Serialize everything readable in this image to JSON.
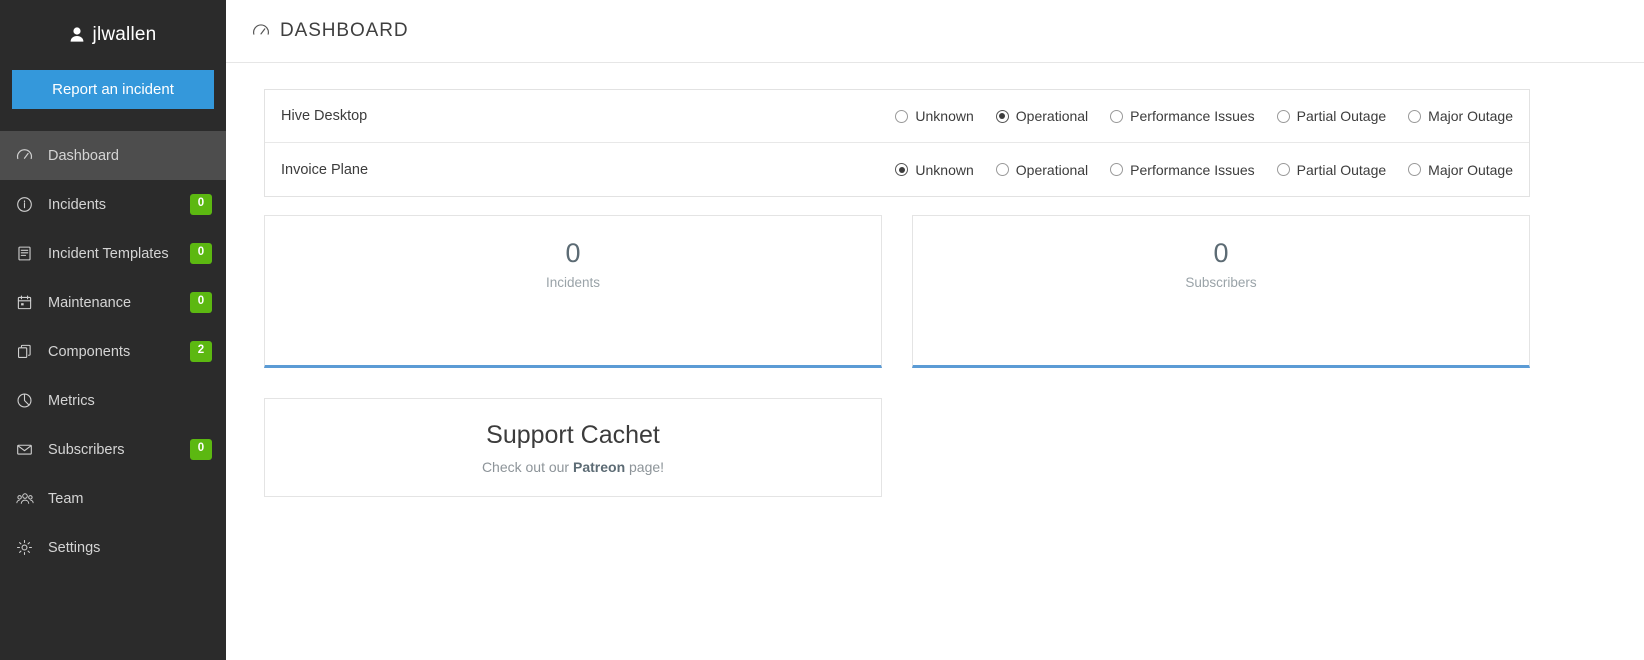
{
  "sidebar": {
    "brand": {
      "username": "jlwallen",
      "icon": "user-icon"
    },
    "report_button": {
      "label": "Report an incident"
    },
    "items": [
      {
        "label": "Dashboard",
        "icon": "dashboard-gauge-icon",
        "badge": null,
        "active": true
      },
      {
        "label": "Incidents",
        "icon": "info-circle-icon",
        "badge": "0",
        "active": false
      },
      {
        "label": "Incident Templates",
        "icon": "list-document-icon",
        "badge": "0",
        "active": false
      },
      {
        "label": "Maintenance",
        "icon": "calendar-icon",
        "badge": "0",
        "active": false
      },
      {
        "label": "Components",
        "icon": "copy-layers-icon",
        "badge": "2",
        "active": false
      },
      {
        "label": "Metrics",
        "icon": "pie-chart-icon",
        "badge": null,
        "active": false
      },
      {
        "label": "Subscribers",
        "icon": "envelope-icon",
        "badge": "0",
        "active": false
      },
      {
        "label": "Team",
        "icon": "users-group-icon",
        "badge": null,
        "active": false
      },
      {
        "label": "Settings",
        "icon": "gear-icon",
        "badge": null,
        "active": false
      }
    ]
  },
  "header": {
    "title": "DASHBOARD",
    "icon": "dashboard-gauge-icon"
  },
  "components_panel": {
    "status_options": [
      "Unknown",
      "Operational",
      "Performance Issues",
      "Partial Outage",
      "Major Outage"
    ],
    "rows": [
      {
        "name": "Hive Desktop",
        "selected_status": "Operational"
      },
      {
        "name": "Invoice Plane",
        "selected_status": "Unknown"
      }
    ]
  },
  "stats": [
    {
      "value": "0",
      "label": "Incidents"
    },
    {
      "value": "0",
      "label": "Subscribers"
    }
  ],
  "support_card": {
    "title": "Support Cachet",
    "text_before": "Check out our ",
    "link_label": "Patreon",
    "text_after": " page!"
  },
  "colors": {
    "sidebar_bg": "#2b2b2b",
    "sidebar_active": "#4d4d4d",
    "accent_blue": "#3498db",
    "badge_green": "#5cb811",
    "card_accent": "#5b9bd5"
  }
}
